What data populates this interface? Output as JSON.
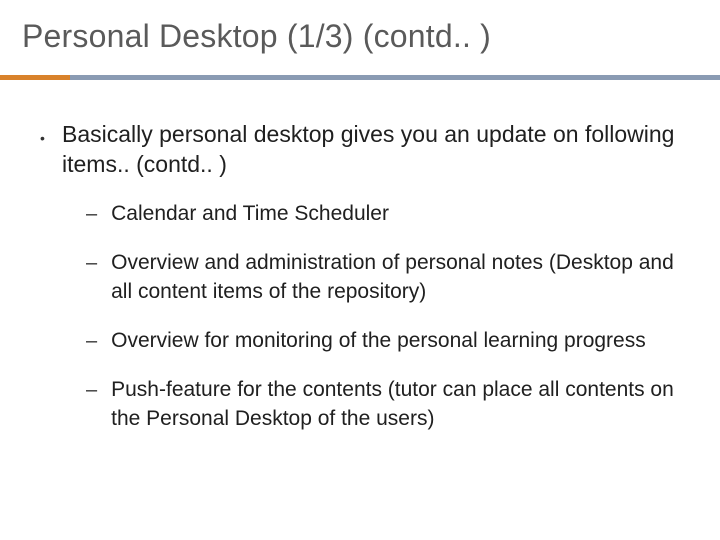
{
  "title": "Personal Desktop (1/3) (contd.. )",
  "main": {
    "lead": "Basically personal desktop gives you an update on following items.. (contd.. )",
    "items": [
      "Calendar and Time Scheduler",
      "Overview and administration of personal notes (Desktop and all content items of the repository)",
      "Overview for monitoring of the personal learning progress",
      "Push-feature for the contents (tutor can place all contents on the Personal Desktop of the users)"
    ]
  },
  "bullets": {
    "dot": "•",
    "dash": "–"
  }
}
